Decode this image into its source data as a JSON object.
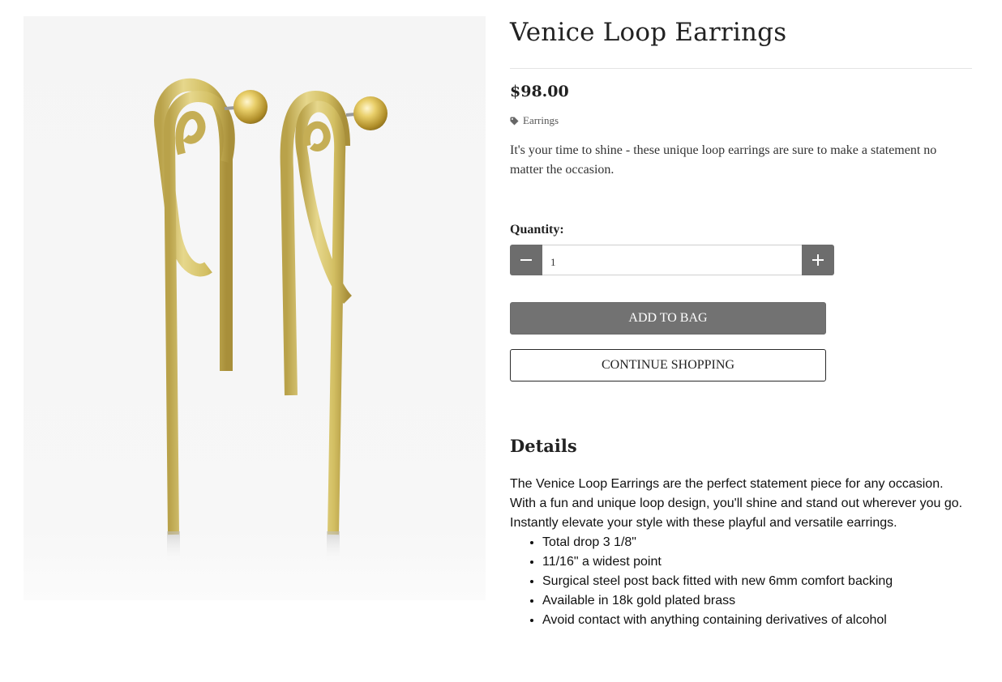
{
  "product": {
    "title": "Venice Loop Earrings",
    "price": "$98.00",
    "category": "Earrings",
    "short_description": "It's your time to shine - these unique loop earrings are sure to make a statement no matter the occasion.",
    "image_alt": "Gold snake chain loop earrings with ball stud"
  },
  "quantity": {
    "label": "Quantity:",
    "value": "1",
    "decrement_icon": "minus-icon",
    "increment_icon": "plus-icon"
  },
  "actions": {
    "add_to_bag": "ADD TO BAG",
    "continue_shopping": "CONTINUE SHOPPING"
  },
  "details": {
    "heading": "Details",
    "paragraph": "The Venice Loop Earrings are the perfect statement piece for any occasion. With a fun and unique loop design, you'll shine and stand out wherever you go. Instantly elevate your style with these playful and versatile earrings.",
    "bullets": [
      "Total drop 3 1/8\"",
      "11/16\" a widest point",
      "Surgical steel post back fitted with new 6mm comfort backing",
      "Available in 18k gold plated brass",
      "Avoid contact with anything containing derivatives of alcohol"
    ]
  },
  "colors": {
    "qty_button": "#6d6d6d",
    "add_button": "#727272",
    "gold": "#d9c66e",
    "text": "#222222"
  },
  "icons": {
    "category": "tag-icon"
  }
}
